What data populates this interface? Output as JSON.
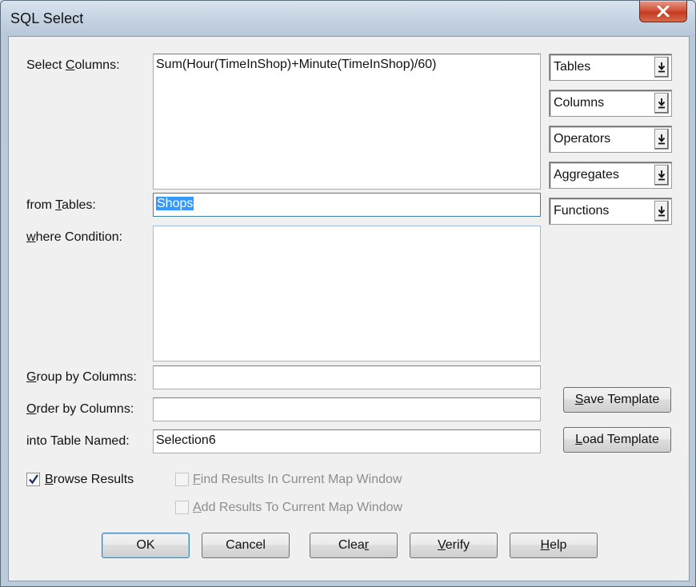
{
  "window": {
    "title": "SQL Select"
  },
  "labels": {
    "select_columns_a": "Select ",
    "select_columns_u": "C",
    "select_columns_b": "olumns:",
    "from_tables_a": "from ",
    "from_tables_u": "T",
    "from_tables_b": "ables:",
    "where_u": "w",
    "where_b": "here Condition:",
    "group_u": "G",
    "group_b": "roup by Columns:",
    "order_u": "O",
    "order_b": "rder by Columns:",
    "into_table": "into Table Named:"
  },
  "fields": {
    "select_columns": "Sum(Hour(TimeInShop)+Minute(TimeInShop)/60)",
    "from_tables": "Shops",
    "where_condition": "",
    "group_by": "",
    "order_by": "",
    "into_table": "Selection6"
  },
  "dropdowns": [
    "Tables",
    "Columns",
    "Operators",
    "Aggregates",
    "Functions"
  ],
  "template_buttons": {
    "save_u": "S",
    "save_b": "ave Template",
    "load_u": "L",
    "load_b": "oad Template"
  },
  "checkboxes": {
    "browse_u": "B",
    "browse_b": "rowse Results",
    "browse_checked": true,
    "find_u": "F",
    "find_b": "ind Results In Current Map Window",
    "find_checked": false,
    "add_u": "A",
    "add_b": "dd Results To Current Map Window",
    "add_checked": false
  },
  "buttons": {
    "ok": "OK",
    "cancel": "Cancel",
    "clear_a": "Clea",
    "clear_u": "r",
    "verify_u": "V",
    "verify_b": "erify",
    "help_u": "H",
    "help_b": "elp"
  },
  "icons": {
    "close": "close-x-icon",
    "dropdown_arrow": "down-arrow-to-bar-icon",
    "checkmark": "checkmark-icon"
  },
  "colors": {
    "selection_highlight": "#3399ff",
    "close_button": "#c43b20",
    "dialog_background": "#f0f0f0"
  }
}
